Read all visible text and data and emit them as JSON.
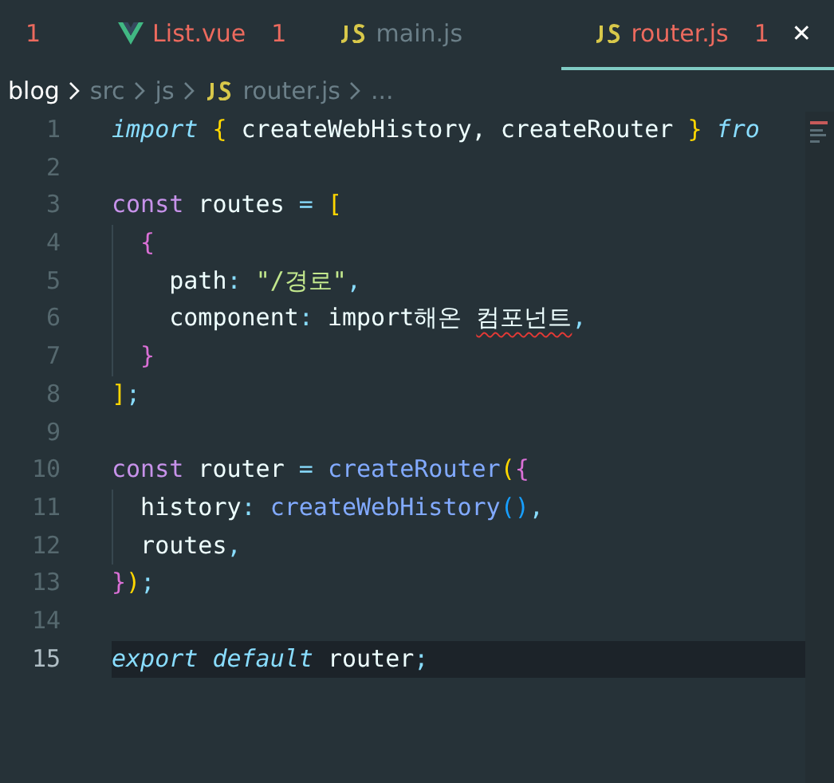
{
  "tabs": [
    {
      "kind": "partial",
      "problems": "1",
      "selected": false,
      "error": true
    },
    {
      "label": "List.vue",
      "kind": "vue",
      "problems": "1",
      "selected": false,
      "error": true
    },
    {
      "label": "main.js",
      "kind": "js",
      "selected": false,
      "error": false
    },
    {
      "label": "router.js",
      "kind": "js",
      "problems": "1",
      "selected": true,
      "error": true,
      "close": "✕"
    }
  ],
  "breadcrumb": [
    {
      "label": "blog",
      "kind": "folder",
      "root": true
    },
    {
      "label": "src",
      "kind": "folder",
      "root": false
    },
    {
      "label": "js",
      "kind": "folder",
      "root": false
    },
    {
      "label": "router.js",
      "kind": "js",
      "root": false
    },
    {
      "label": "...",
      "kind": "folder",
      "root": false
    }
  ],
  "code": [
    {
      "number": "1",
      "current": false,
      "tokens": [
        {
          "text": "import",
          "kind": "kwi"
        },
        {
          "text": " {",
          "kind": "b1"
        },
        {
          "text": " createWebHistory, createRouter ",
          "kind": "plain"
        },
        {
          "text": "}",
          "kind": "b1"
        },
        {
          "text": " fro",
          "kind": "kwi"
        }
      ]
    },
    {
      "number": "2",
      "current": false
    },
    {
      "number": "3",
      "current": false,
      "tokens": [
        {
          "text": "const",
          "kind": "keyword"
        },
        {
          "text": " routes ",
          "kind": "plain"
        },
        {
          "text": "=",
          "kind": "punct"
        },
        {
          "text": " [",
          "kind": "b1"
        }
      ]
    },
    {
      "number": "4",
      "current": false,
      "tokens": [
        {
          "text": "  {",
          "kind": "b2"
        }
      ]
    },
    {
      "number": "5",
      "current": false,
      "tokens": [
        {
          "text": "    path",
          "kind": "plain"
        },
        {
          "text": ": ",
          "kind": "punct"
        },
        {
          "text": "\"/경로\"",
          "kind": "string"
        },
        {
          "text": ",",
          "kind": "punct"
        }
      ]
    },
    {
      "number": "6",
      "current": false,
      "tokens": [
        {
          "text": "    component",
          "kind": "plain"
        },
        {
          "text": ": ",
          "kind": "punct"
        },
        {
          "text": "import해온 ",
          "kind": "plain"
        },
        {
          "text": "컴포넌트",
          "kind": "plain",
          "error": true
        },
        {
          "text": ",",
          "kind": "punct"
        }
      ]
    },
    {
      "number": "7",
      "current": false,
      "tokens": [
        {
          "text": "  }",
          "kind": "b2"
        }
      ]
    },
    {
      "number": "8",
      "current": false,
      "tokens": [
        {
          "text": "]",
          "kind": "b1"
        },
        {
          "text": ";",
          "kind": "punct"
        }
      ]
    },
    {
      "number": "9",
      "current": false
    },
    {
      "number": "10",
      "current": false,
      "tokens": [
        {
          "text": "const",
          "kind": "keyword"
        },
        {
          "text": " router ",
          "kind": "plain"
        },
        {
          "text": "=",
          "kind": "punct"
        },
        {
          "text": " createRouter",
          "kind": "func"
        },
        {
          "text": "(",
          "kind": "b1"
        },
        {
          "text": "{",
          "kind": "b2"
        }
      ]
    },
    {
      "number": "11",
      "current": false,
      "tokens": [
        {
          "text": "  history",
          "kind": "plain"
        },
        {
          "text": ": ",
          "kind": "punct"
        },
        {
          "text": "createWebHistory",
          "kind": "func"
        },
        {
          "text": "()",
          "kind": "b3"
        },
        {
          "text": ",",
          "kind": "punct"
        }
      ]
    },
    {
      "number": "12",
      "current": false,
      "tokens": [
        {
          "text": "  routes",
          "kind": "plain"
        },
        {
          "text": ",",
          "kind": "punct"
        }
      ]
    },
    {
      "number": "13",
      "current": false,
      "tokens": [
        {
          "text": "}",
          "kind": "b2"
        },
        {
          "text": ")",
          "kind": "b1"
        },
        {
          "text": ";",
          "kind": "punct"
        }
      ]
    },
    {
      "number": "14",
      "current": false
    },
    {
      "number": "15",
      "current": true,
      "tokens": [
        {
          "text": "export",
          "kind": "kwi"
        },
        {
          "text": " default",
          "kind": "kwi"
        },
        {
          "text": " router",
          "kind": "plain"
        },
        {
          "text": ";",
          "kind": "punct"
        }
      ]
    }
  ]
}
